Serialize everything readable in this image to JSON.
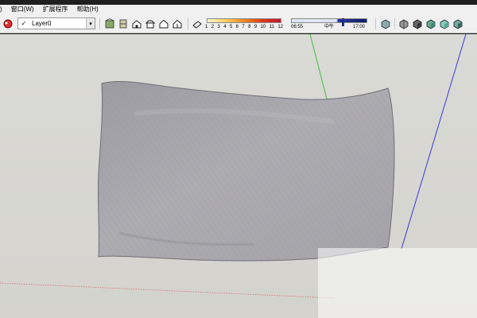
{
  "menubar": {
    "items": [
      {
        "label": ")"
      },
      {
        "label": "窗口(W)"
      },
      {
        "label": "扩展程序"
      },
      {
        "label": "帮助(H)"
      }
    ]
  },
  "toolbar": {
    "layer": {
      "check": "✓",
      "name": "Layer0",
      "arrow": "▾"
    },
    "month_slider": {
      "labels": [
        "1",
        "2",
        "3",
        "4",
        "5",
        "6",
        "7",
        "8",
        "9",
        "10",
        "11",
        "12"
      ]
    },
    "time_slider": {
      "start": "06:55",
      "middle": "中午",
      "end": "17:00",
      "position": 0.64
    },
    "icons": [
      "layer-manager-icon",
      "warehouse-icon",
      "components-icon",
      "iso-view-icon",
      "top-view-icon",
      "front-view-icon",
      "right-view-icon",
      "back-view-icon",
      "left-view-icon",
      "shadow-toggle-icon",
      "style-wireframe-icon",
      "style-hidden-line-icon",
      "style-shaded-icon",
      "style-textured-icon",
      "style-monochrome-icon"
    ]
  },
  "viewport": {
    "object": "pillow-model",
    "axes": {
      "green": "#3fbf3f",
      "blue": "#3a3adf",
      "red": "#d03a3a"
    },
    "background": "#d8d7d2",
    "model_color": "#a9a8ad"
  }
}
